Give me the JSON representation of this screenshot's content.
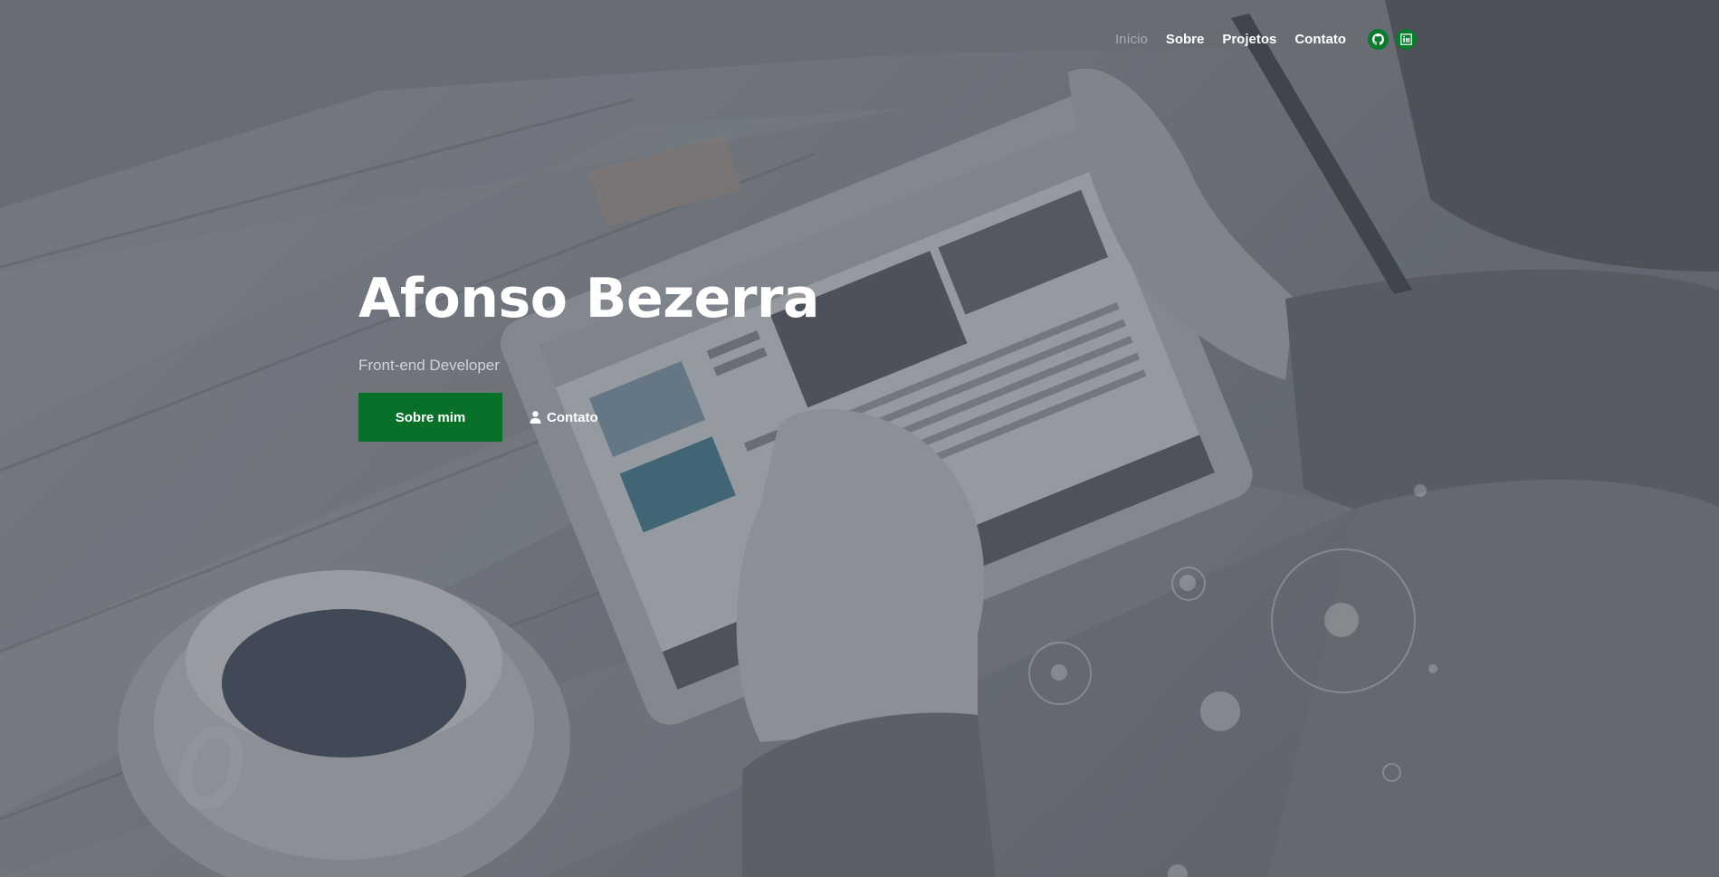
{
  "nav": {
    "links": [
      {
        "label": "Início",
        "active": true
      },
      {
        "label": "Sobre",
        "active": false
      },
      {
        "label": "Projetos",
        "active": false
      },
      {
        "label": "Contato",
        "active": false
      }
    ],
    "icons": [
      "github-icon",
      "linkedin-icon"
    ]
  },
  "hero": {
    "title": "Afonso Bezerra",
    "subtitle": "Front-end Developer",
    "primary_button": "Sobre mim",
    "secondary_button": "Contato"
  },
  "colors": {
    "accent": "#087029",
    "icon_bg": "#087b2c",
    "text": "#ffffff",
    "nav_active": "#a8acb3"
  }
}
